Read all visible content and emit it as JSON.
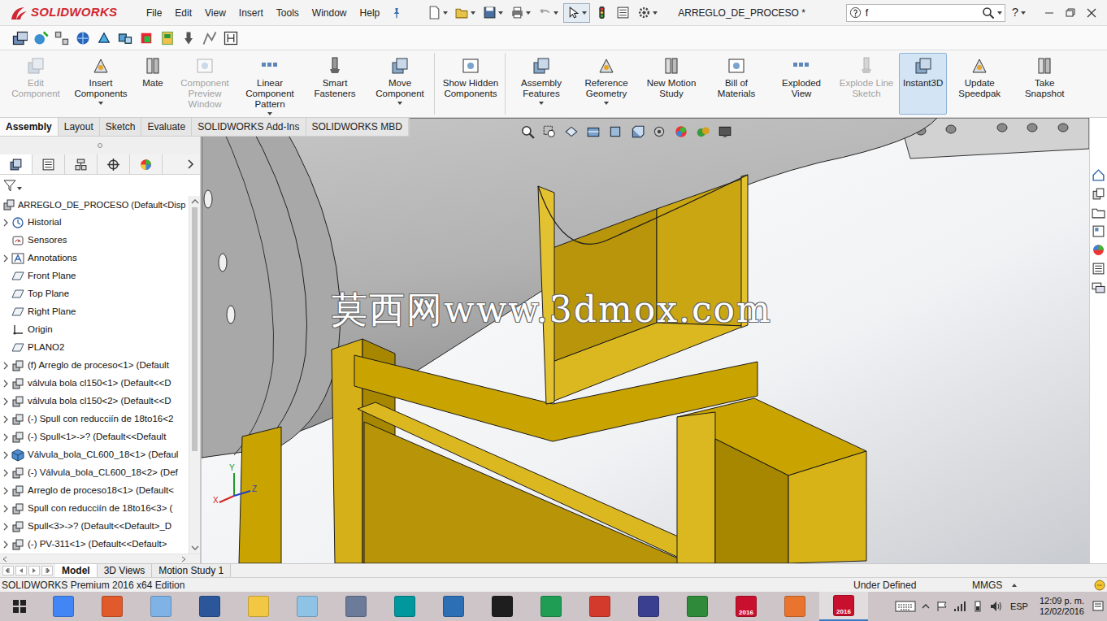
{
  "window": {
    "app": "SOLIDWORKS",
    "title": "ARREGLO_DE_PROCESO *"
  },
  "menu": [
    "File",
    "Edit",
    "View",
    "Insert",
    "Tools",
    "Window",
    "Help"
  ],
  "search": {
    "value": "f"
  },
  "help": "?",
  "ribbon": [
    [
      {
        "label": "Edit Component",
        "disabled": true,
        "selected": false,
        "dropdown": false
      },
      {
        "label": "Insert Components",
        "disabled": false,
        "selected": false,
        "dropdown": true
      },
      {
        "label": "Mate",
        "disabled": false,
        "selected": false,
        "dropdown": false
      },
      {
        "label": "Component Preview Window",
        "disabled": true,
        "selected": false,
        "dropdown": false
      },
      {
        "label": "Linear Component Pattern",
        "disabled": false,
        "selected": false,
        "dropdown": true
      },
      {
        "label": "Smart Fasteners",
        "disabled": false,
        "selected": false,
        "dropdown": false
      },
      {
        "label": "Move Component",
        "disabled": false,
        "selected": false,
        "dropdown": true
      }
    ],
    [
      {
        "label": "Show Hidden Components",
        "disabled": false,
        "selected": false,
        "dropdown": false
      }
    ],
    [
      {
        "label": "Assembly Features",
        "disabled": false,
        "selected": false,
        "dropdown": true
      },
      {
        "label": "Reference Geometry",
        "disabled": false,
        "selected": false,
        "dropdown": true
      },
      {
        "label": "New Motion Study",
        "disabled": false,
        "selected": false,
        "dropdown": false
      },
      {
        "label": "Bill of Materials",
        "disabled": false,
        "selected": false,
        "dropdown": false
      },
      {
        "label": "Exploded View",
        "disabled": false,
        "selected": false,
        "dropdown": false
      },
      {
        "label": "Explode Line Sketch",
        "disabled": true,
        "selected": false,
        "dropdown": false
      },
      {
        "label": "Instant3D",
        "disabled": false,
        "selected": true,
        "dropdown": false
      },
      {
        "label": "Update Speedpak",
        "disabled": false,
        "selected": false,
        "dropdown": false
      },
      {
        "label": "Take Snapshot",
        "disabled": false,
        "selected": false,
        "dropdown": false
      }
    ]
  ],
  "tabs": [
    {
      "label": "Assembly",
      "selected": true
    },
    {
      "label": "Layout",
      "selected": false
    },
    {
      "label": "Sketch",
      "selected": false
    },
    {
      "label": "Evaluate",
      "selected": false
    },
    {
      "label": "SOLIDWORKS Add-Ins",
      "selected": false
    },
    {
      "label": "SOLIDWORKS MBD",
      "selected": false
    }
  ],
  "panel_tabs": [
    {
      "selected": true
    },
    {
      "selected": false
    },
    {
      "selected": false
    },
    {
      "selected": false
    },
    {
      "selected": false
    }
  ],
  "tree": {
    "root": {
      "label": "ARREGLO_DE_PROCESO (Default<Disp"
    },
    "items": [
      {
        "label": "Historial",
        "kind": "history",
        "expandable": true
      },
      {
        "label": "Sensores",
        "kind": "sensor",
        "expandable": false
      },
      {
        "label": "Annotations",
        "kind": "annotation",
        "expandable": true
      },
      {
        "label": "Front Plane",
        "kind": "plane",
        "expandable": false
      },
      {
        "label": "Top Plane",
        "kind": "plane",
        "expandable": false
      },
      {
        "label": "Right Plane",
        "kind": "plane",
        "expandable": false
      },
      {
        "label": "Origin",
        "kind": "origin",
        "expandable": false
      },
      {
        "label": "PLANO2",
        "kind": "plane",
        "expandable": false
      },
      {
        "label": "(f) Arreglo de proceso<1> (Default",
        "kind": "assembly",
        "expandable": true
      },
      {
        "label": "válvula bola cl150<1> (Default<<D",
        "kind": "assembly",
        "expandable": true
      },
      {
        "label": "válvula bola cl150<2> (Default<<D",
        "kind": "assembly",
        "expandable": true
      },
      {
        "label": "(-) Spull con reducciín de 18to16<2",
        "kind": "assembly",
        "expandable": true
      },
      {
        "label": "(-) Spull<1>->? (Default<<Default",
        "kind": "assembly",
        "expandable": true
      },
      {
        "label": "Válvula_bola_CL600_18<1> (Defaul",
        "kind": "part",
        "expandable": true
      },
      {
        "label": "(-) Válvula_bola_CL600_18<2> (Def",
        "kind": "assembly",
        "expandable": true
      },
      {
        "label": "Arreglo de proceso18<1> (Default<",
        "kind": "assembly",
        "expandable": true
      },
      {
        "label": "Spull con reducciín de 18to16<3> (",
        "kind": "assembly",
        "expandable": true
      },
      {
        "label": "Spull<3>->? (Default<<Default>_D",
        "kind": "assembly",
        "expandable": true
      },
      {
        "label": "(-) PV-311<1> (Default<<Default>",
        "kind": "assembly",
        "expandable": true
      }
    ]
  },
  "viewport": {
    "watermark": "莫西网www.3dmox.com",
    "triad": [
      {
        "label": "Y",
        "color": "#1f9a2a"
      },
      {
        "label": "X",
        "color": "#d42020"
      },
      {
        "label": "Z",
        "color": "#2040c8"
      }
    ]
  },
  "bottom_tabs": [
    {
      "label": "Model",
      "selected": true
    },
    {
      "label": "3D Views",
      "selected": false
    },
    {
      "label": "Motion Study 1",
      "selected": false
    }
  ],
  "status_bar": {
    "edition": "SOLIDWORKS Premium 2016 x64 Edition",
    "state": "Under Defined",
    "units": "MMGS"
  },
  "taskbar": {
    "apps": [
      {
        "active": false
      },
      {
        "active": false
      },
      {
        "active": false
      },
      {
        "active": false
      },
      {
        "active": false
      },
      {
        "active": false
      },
      {
        "active": false
      },
      {
        "active": false
      },
      {
        "active": false
      },
      {
        "active": false
      },
      {
        "active": false
      },
      {
        "active": false
      },
      {
        "active": false
      },
      {
        "active": false
      },
      {
        "active": false,
        "label": "2016"
      },
      {
        "active": false
      },
      {
        "active": true,
        "label": "2016"
      }
    ],
    "lang": "ESP",
    "time": "12:09 p. m.",
    "date": "12/02/2016"
  }
}
